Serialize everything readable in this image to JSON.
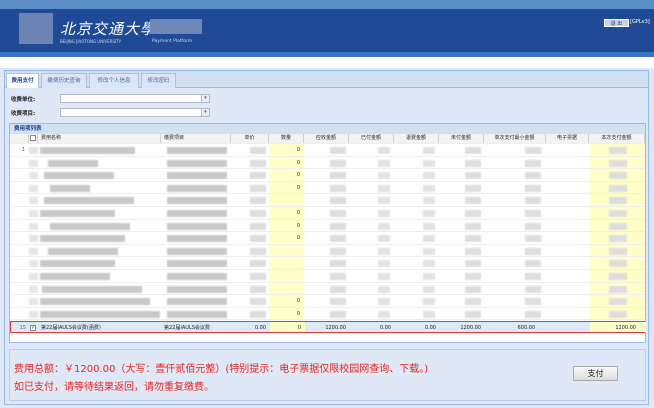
{
  "header": {
    "university_en": "BEIJING JIAOTONG UNIVERSITY",
    "university_cn": "北京交通大學",
    "platform": "Payment  Platform",
    "logout_label": "退 出",
    "version": "[GPLv3]"
  },
  "tabs": [
    "费用支付",
    "缴费历史查询",
    "修改个人信息",
    "修改密码"
  ],
  "form": {
    "unit_label": "收费单位:",
    "item_label": "收费项目:",
    "unit_value": "",
    "item_value": ""
  },
  "grid": {
    "title": "费用项列表",
    "columns": [
      "费用名称",
      "缴费项目",
      "单价",
      "数量",
      "应收金额",
      "已付金额",
      "退费金额",
      "未付金额",
      "单次支付最小金额",
      "电子票据",
      "本次支付金额"
    ],
    "blurred_row_numbers": [
      "1",
      "",
      "",
      "",
      "",
      "",
      "",
      "",
      "",
      "",
      "",
      "",
      "",
      ""
    ],
    "blurred_row_qty": [
      "0",
      "0",
      "0",
      "0",
      "",
      "0",
      "0",
      "0",
      "",
      "",
      "",
      "",
      "0",
      "0"
    ],
    "selected_row": {
      "index": "15",
      "checked": true,
      "name": "第22届IAULS会议费(函费)",
      "item": "第22届IAULS会议费",
      "unit_price": "0.00",
      "quantity": "0",
      "receivable": "1200.00",
      "paid": "0.00",
      "refund": "0.00",
      "unpaid": "1200.00",
      "min_payment": "600.00",
      "e_receipt": "",
      "this_payment": "1200.00"
    }
  },
  "footer": {
    "total_line": "费用总额：￥1200.00（大写：壹仟贰佰元整）(特别提示：电子票据仅限校园网查询、下载。)",
    "warning_line": "如已支付，请等待结果返回，请勿重复缴费。",
    "pay_label": "支付"
  },
  "colors": {
    "header": "#1f4a95",
    "alert": "#e8251f",
    "highlight_column": "#ffffc8",
    "selected_border": "#e03a3a"
  }
}
